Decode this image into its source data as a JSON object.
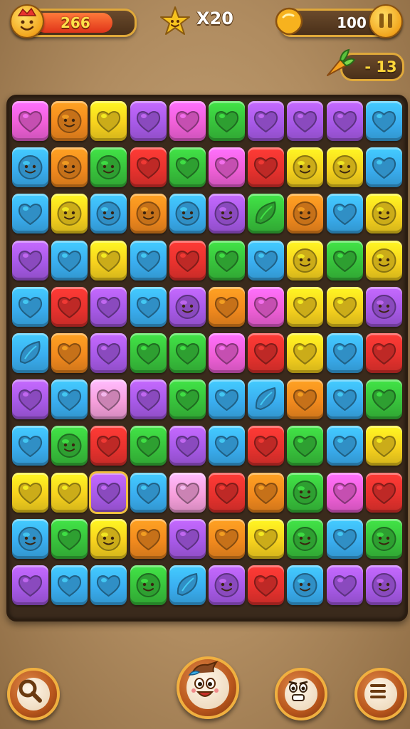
{
  "hud": {
    "lives": {
      "value": "266",
      "fill_fraction": 0.8,
      "icon": "flame-face-icon"
    },
    "star": {
      "icon": "star-face-icon",
      "multiplier": "X20"
    },
    "coins": {
      "value": "100",
      "icon": "coin-icon"
    },
    "pause": {
      "icon": "pause-icon"
    },
    "moves": {
      "value": "- 13",
      "icon": "carrot-icon"
    }
  },
  "colors": {
    "yellow": "#f7d21e",
    "orange": "#f28a1e",
    "green": "#38c23c",
    "blue": "#3aaef0",
    "purple": "#a85ae8",
    "pink": "#f060d8",
    "red": "#e8322e",
    "lightpink": "#f7a0dc"
  },
  "board": {
    "cols": 10,
    "rows": 11,
    "selected": [
      8,
      2
    ],
    "cells": [
      [
        "pink:heart",
        "orange:face",
        "yellow:heart",
        "purple:heart",
        "pink:heart",
        "green:heart",
        "purple:heart",
        "purple:heart",
        "purple:heart",
        "blue:heart"
      ],
      [
        "blue:face",
        "orange:face",
        "green:face",
        "red:heart",
        "green:heart",
        "pink:heart",
        "red:heart",
        "yellow:face",
        "yellow:face",
        "blue:heart"
      ],
      [
        "blue:heart",
        "yellow:face",
        "blue:face",
        "orange:face",
        "blue:face",
        "purple:face",
        "green:leaf",
        "orange:face",
        "blue:heart",
        "yellow:face"
      ],
      [
        "purple:heart",
        "blue:heart",
        "yellow:heart",
        "blue:heart",
        "red:heart",
        "green:heart",
        "blue:heart",
        "yellow:face",
        "green:heart",
        "yellow:face"
      ],
      [
        "blue:heart",
        "red:heart",
        "purple:heart",
        "blue:heart",
        "purple:face",
        "orange:heart",
        "pink:heart",
        "yellow:heart",
        "yellow:heart",
        "purple:face"
      ],
      [
        "blue:leaf",
        "orange:heart",
        "purple:heart",
        "green:heart",
        "green:heart",
        "pink:heart",
        "red:heart",
        "yellow:heart",
        "blue:heart",
        "red:heart"
      ],
      [
        "purple:heart",
        "blue:heart",
        "lightpink:heart",
        "purple:heart",
        "green:heart",
        "blue:heart",
        "blue:leaf",
        "orange:heart",
        "blue:heart",
        "green:heart"
      ],
      [
        "blue:heart",
        "green:face",
        "red:heart",
        "green:heart",
        "purple:heart",
        "blue:heart",
        "red:heart",
        "green:heart",
        "blue:heart",
        "yellow:heart"
      ],
      [
        "yellow:heart",
        "yellow:heart",
        "purple:heart",
        "blue:heart",
        "lightpink:heart",
        "red:heart",
        "orange:heart",
        "green:face",
        "pink:heart",
        "red:heart"
      ],
      [
        "blue:face",
        "green:heart",
        "yellow:face",
        "orange:heart",
        "purple:heart",
        "orange:heart",
        "yellow:heart",
        "green:face",
        "blue:heart",
        "green:face"
      ],
      [
        "purple:heart",
        "blue:heart",
        "blue:heart",
        "green:face",
        "blue:leaf",
        "purple:face",
        "red:heart",
        "blue:face",
        "purple:heart",
        "purple:face"
      ]
    ]
  },
  "bottom_bar": {
    "search": {
      "icon": "magnifier-icon"
    },
    "mascot": {
      "icon": "mascot-face-icon"
    },
    "face": {
      "icon": "worried-face-icon"
    },
    "menu": {
      "icon": "hamburger-menu-icon"
    }
  }
}
